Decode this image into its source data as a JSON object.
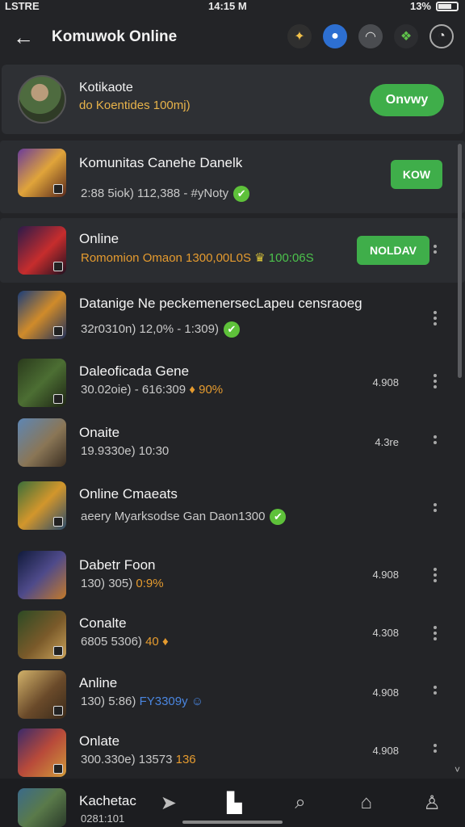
{
  "status": {
    "carrier": "LSTRE",
    "time": "14:15 M",
    "battery": "13%"
  },
  "header": {
    "title": "Komuwok Online"
  },
  "featured": {
    "title": "Kotikaote",
    "subtitle": "do Koentides 100mj)",
    "button": "Onvwy"
  },
  "rows": [
    {
      "title": "Komunitas Canehe Danelk",
      "sub": "2:88 5iok) 112,388 - #yNoty",
      "button": "KOW"
    },
    {
      "title": "Online",
      "sub": "Romomion Omaon 1300,00L0S",
      "sub_accent": "100:06S",
      "button": "NOLDAV"
    },
    {
      "title": "Datanige Ne peckemenersecLapeu censraoeg",
      "sub": "32r0310n) 12,0% - 1:309)"
    },
    {
      "title": "Daleoficada Gene",
      "sub": "30.02oie) - 616:309",
      "sub_accent": "90%",
      "score": "4.908"
    },
    {
      "title": "Onaite",
      "sub": "19.9330e) 10:30",
      "score": "4.3re"
    },
    {
      "title": "Online Cmaeats",
      "sub": "aeery Myarksodse Gan Daon1300"
    },
    {
      "title": "Dabetr Foon",
      "sub": "130) 305)",
      "sub_accent": "0:9%",
      "score": "4.908"
    },
    {
      "title": "Conalte",
      "sub": "6805 5306)",
      "sub_accent": "40",
      "score": "4.308"
    },
    {
      "title": "Anline",
      "sub": "130) 5:86)",
      "sub_accent": "FY3309y",
      "score": "4.908"
    },
    {
      "title": "Onlate",
      "sub": "300.330e) 13573",
      "sub_accent": "136",
      "score": "4.908"
    },
    {
      "title": "Kachetac",
      "sub": "0281:101"
    }
  ],
  "icons": {
    "back": "arrow-left",
    "more": "vertical-dots",
    "verified": "check-circle",
    "nav": [
      "bookmark",
      "home",
      "search",
      "store",
      "profile"
    ]
  },
  "colors": {
    "accent_green": "#3fae4a",
    "accent_orange": "#e59b2f",
    "background": "#232427"
  }
}
